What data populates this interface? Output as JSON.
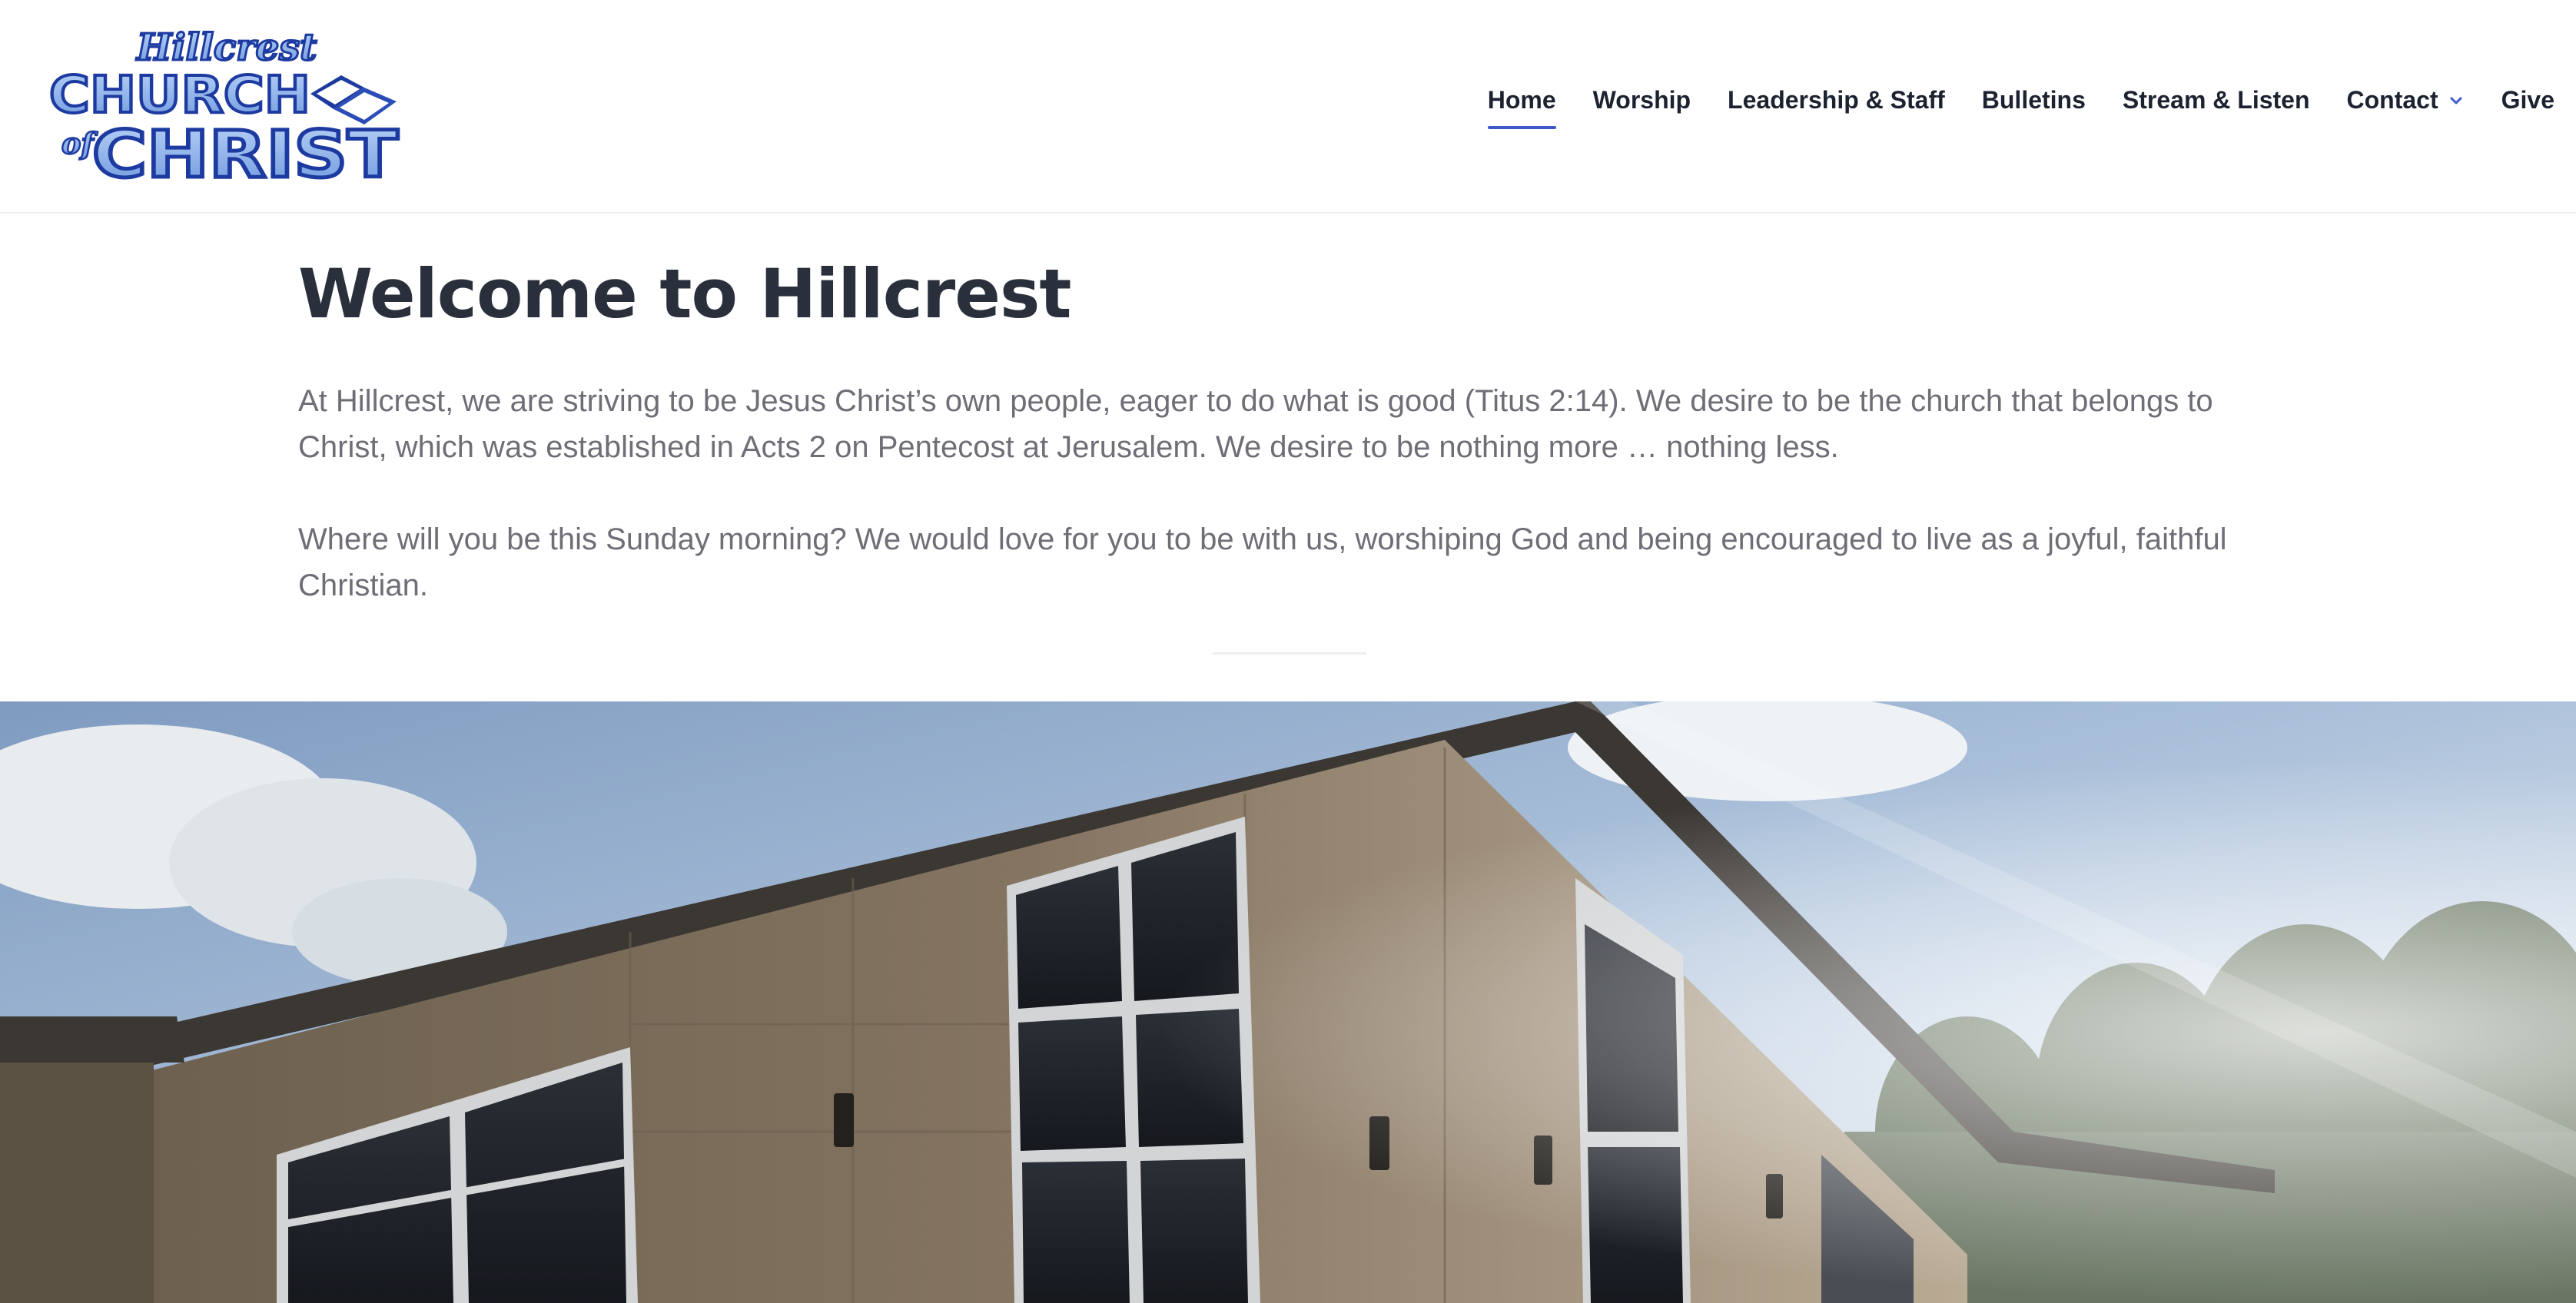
{
  "site": {
    "logo_alt": "Hillcrest Church of Christ",
    "logo_lines": [
      "Hillcrest",
      "CHURCH",
      "of",
      "CHRIST"
    ]
  },
  "nav": {
    "items": [
      {
        "label": "Home",
        "active": true
      },
      {
        "label": "Worship"
      },
      {
        "label": "Leadership & Staff"
      },
      {
        "label": "Bulletins"
      },
      {
        "label": "Stream & Listen"
      },
      {
        "label": "Contact",
        "has_dropdown": true
      },
      {
        "label": "Give"
      }
    ],
    "accent_color": "#3f58c7"
  },
  "intro": {
    "title": "Welcome to Hillcrest",
    "paragraph1": "At Hillcrest, we are striving to be Jesus Christ’s own people, eager to do what is good (Titus 2:14). We desire to be the church that belongs to Christ, which was established in Acts 2 on Pentecost at Jerusalem. We desire to be nothing more … nothing less.",
    "paragraph2": "Where will you be this Sunday morning? We would love for you to be with us, worshiping God and being encouraged to live as a joyful, faithful Christian."
  },
  "hero": {
    "alt": "Hillcrest church building exterior with sky and trees"
  },
  "colors": {
    "text_dark": "#1d2231",
    "heading": "#2a2f3c",
    "body_text": "#6e6e77",
    "logo_blue": "#1d3aa0",
    "logo_light": "#8fb3ea"
  }
}
